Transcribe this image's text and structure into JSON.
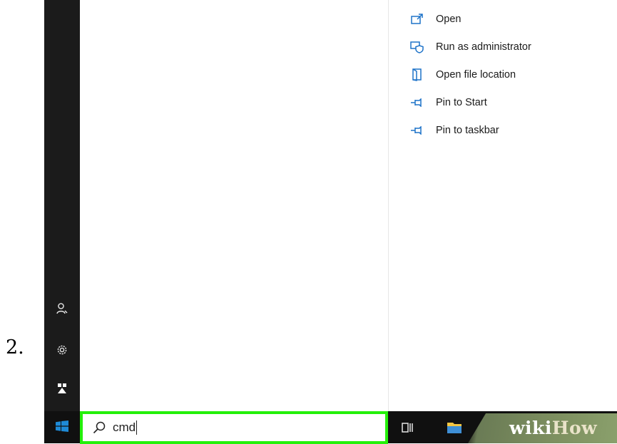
{
  "step": {
    "number": "2."
  },
  "context_menu": {
    "items": [
      {
        "label": "Open",
        "icon": "open-window-icon"
      },
      {
        "label": "Run as administrator",
        "icon": "shield-admin-icon"
      },
      {
        "label": "Open file location",
        "icon": "folder-location-icon"
      },
      {
        "label": "Pin to Start",
        "icon": "pin-icon"
      },
      {
        "label": "Pin to taskbar",
        "icon": "pin-icon"
      }
    ]
  },
  "start_rail": {
    "icons": [
      "user-account-icon",
      "settings-gear-icon",
      "power-user-icon"
    ]
  },
  "taskbar": {
    "search_value": "cmd",
    "highlight_color": "#24f00a",
    "icons": [
      "task-view-icon",
      "file-explorer-icon",
      "chrome-icon"
    ]
  },
  "watermark": {
    "part1": "wiki",
    "part2": "How"
  },
  "colors": {
    "accent_blue": "#1e73c9",
    "taskbar_bg": "#101010",
    "rail_bg": "#1b1b1b"
  }
}
